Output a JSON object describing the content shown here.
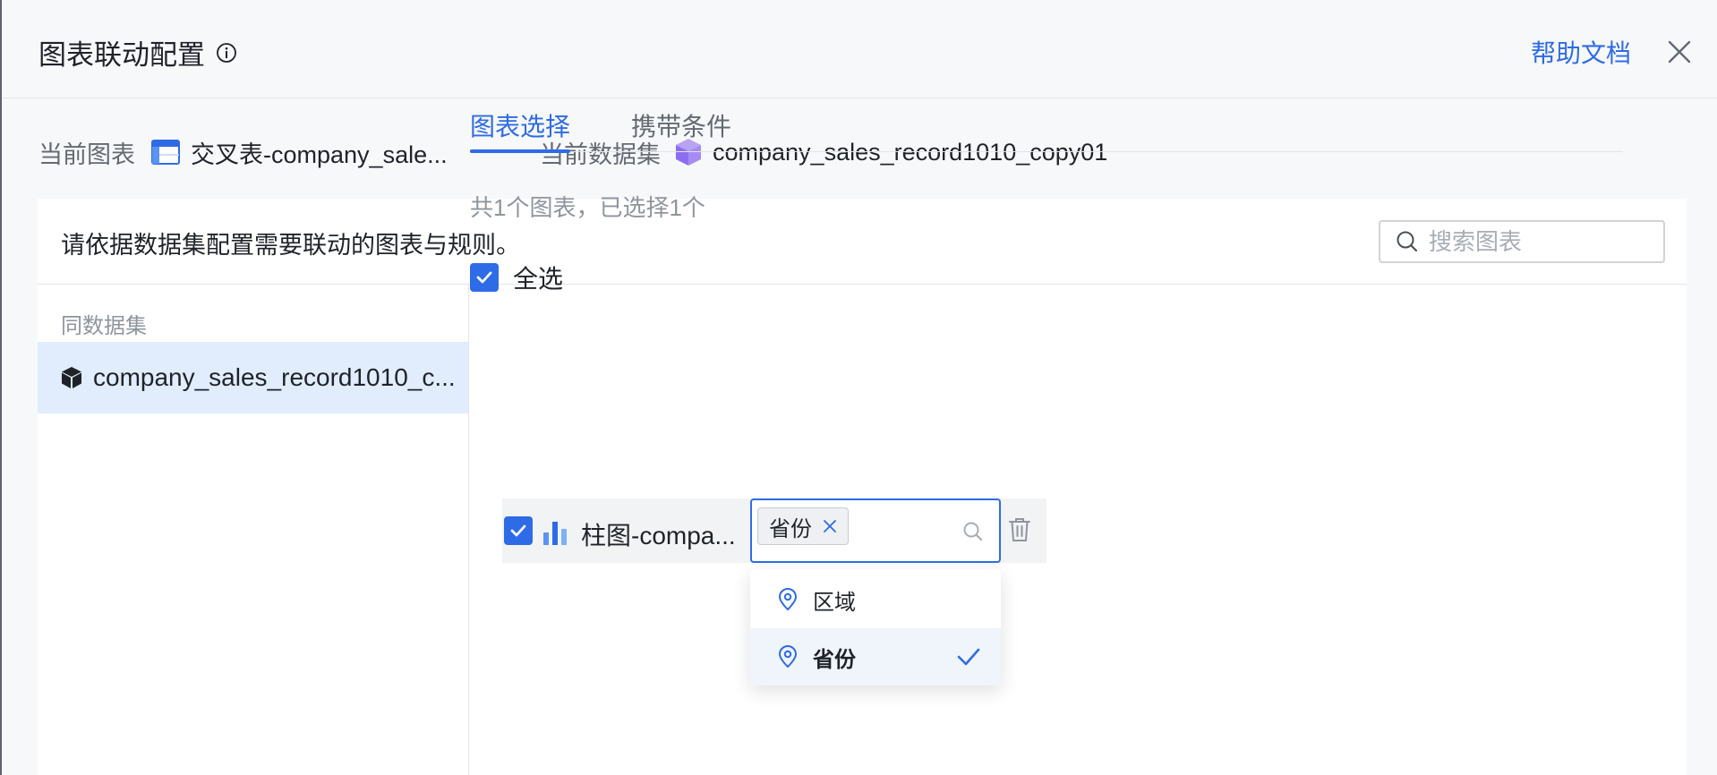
{
  "modal": {
    "title": "图表联动配置",
    "help_link": "帮助文档"
  },
  "info": {
    "current_chart_label": "当前图表",
    "current_chart_value": "交叉表-company_sale...",
    "current_dataset_label": "当前数据集",
    "current_dataset_value": "company_sales_record1010_copy01"
  },
  "panel": {
    "instruction": "请依据数据集配置需要联动的图表与规则。",
    "search_placeholder": "搜索图表"
  },
  "sidebar": {
    "heading": "同数据集",
    "items": [
      {
        "label": "company_sales_record1010_c..."
      }
    ]
  },
  "tabs": [
    {
      "label": "图表选择",
      "active": true
    },
    {
      "label": "携带条件",
      "active": false
    }
  ],
  "chart_selection": {
    "count_text": "共1个图表，已选择1个",
    "select_all_label": "全选",
    "charts": [
      {
        "name": "柱图-compa...",
        "condition_tags": [
          "省份"
        ]
      }
    ]
  },
  "dropdown": {
    "options": [
      {
        "label": "区域",
        "selected": false
      },
      {
        "label": "省份",
        "selected": true
      }
    ]
  },
  "colors": {
    "accent": "#2e6be6",
    "selected_bg": "#e1edfd"
  }
}
